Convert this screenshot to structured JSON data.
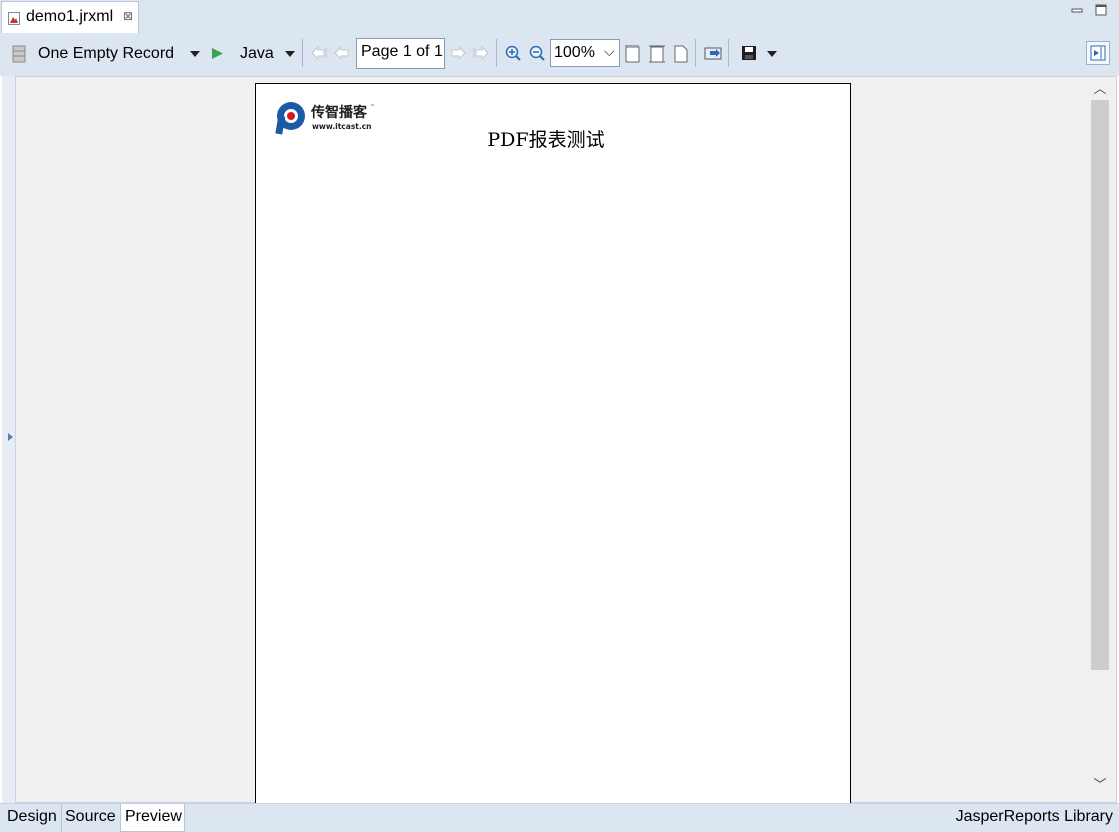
{
  "editor_tab": {
    "title": "demo1.jrxml",
    "close_symbol": "⊠"
  },
  "toolbar": {
    "data_adapter": "One Empty Record",
    "language": "Java",
    "page_indicator": "Page 1 of 1",
    "zoom": "100%"
  },
  "report": {
    "logo_brand": "传智播客",
    "logo_url": "www.itcast.cn",
    "title": "PDF报表测试"
  },
  "bottom_tabs": [
    "Design",
    "Source",
    "Preview"
  ],
  "active_bottom_tab": "Preview",
  "status_right": "JasperReports Library",
  "colors": {
    "chrome": "#dce6f1",
    "accent": "#1c5aa8",
    "logo_red": "#d7191f"
  }
}
